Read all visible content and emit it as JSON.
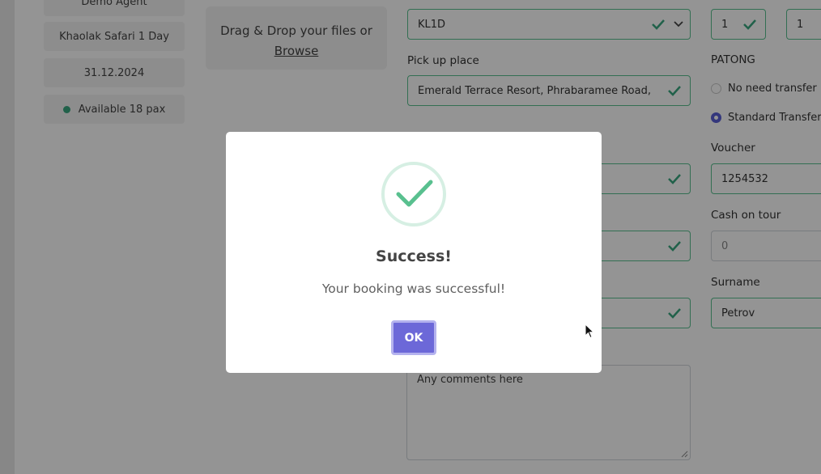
{
  "left_info": {
    "agent": "Demo Agent",
    "tour": "Khaolak Safari 1 Day",
    "date": "31.12.2024",
    "availability": "Available 18 pax"
  },
  "upload": {
    "text": "Drag & Drop your files or",
    "browse": "Browse"
  },
  "form": {
    "hotel_code": "KL1D",
    "pickup_label": "Pick up place",
    "pickup_value": "Emerald Terrace Resort, Phrabaramee Road,",
    "adults": "1",
    "children": "1",
    "area_label": "PATONG",
    "transfer_options": [
      {
        "label": "No need transfer",
        "selected": false
      },
      {
        "label": "Standard Transfer",
        "selected": true
      }
    ],
    "voucher_label": "Voucher",
    "voucher_value": "1254532",
    "cash_label": "Cash on tour",
    "cash_value": "0",
    "surname_label": "Surname",
    "surname_value": "Petrov",
    "comments_placeholder": "Any comments here"
  },
  "modal": {
    "title": "Success!",
    "message": "Your booking was successful!",
    "ok_label": "OK"
  },
  "colors": {
    "accent": "#6c68d8",
    "success": "#59c08f",
    "radio_selected": "#5a5fd6"
  }
}
